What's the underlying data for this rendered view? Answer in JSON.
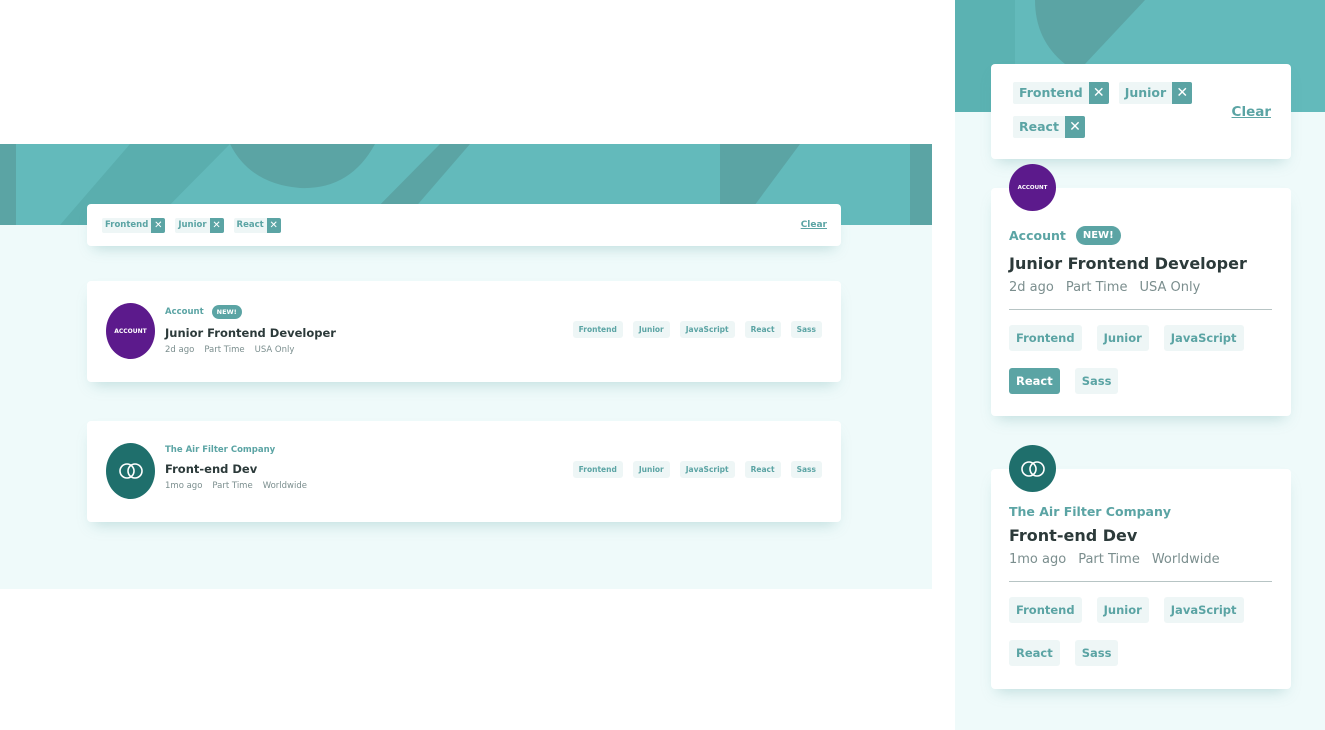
{
  "colors": {
    "primary": "#5ba4a4",
    "background": "#effafa",
    "filter_tablet": "#eef6f6",
    "dark_text": "#2c3a3a",
    "gray_text": "#7b8e8e",
    "logo_account": "#5c1a8c",
    "logo_air": "#1f6f6c"
  },
  "filters": {
    "chips": [
      {
        "label": "Frontend",
        "icon": "close-icon"
      },
      {
        "label": "Junior",
        "icon": "close-icon"
      },
      {
        "label": "React",
        "icon": "close-icon"
      }
    ],
    "remove_glyph": "✕",
    "clear_label": "Clear"
  },
  "jobs": [
    {
      "logo_text": "ACCOUNT",
      "logo_icon": "account-logo-icon",
      "company": "Account",
      "badge": "NEW!",
      "position": "Junior Frontend Developer",
      "posted": "2d ago",
      "contract": "Part Time",
      "location": "USA Only",
      "tags": [
        "Frontend",
        "Junior",
        "JavaScript",
        "React",
        "Sass"
      ],
      "active_tag_mobile": "React"
    },
    {
      "logo_text": "",
      "logo_icon": "rings-logo-icon",
      "company": "The Air Filter Company",
      "badge": "",
      "position": "Front-end Dev",
      "posted": "1mo ago",
      "contract": "Part Time",
      "location": "Worldwide",
      "tags": [
        "Frontend",
        "Junior",
        "JavaScript",
        "React",
        "Sass"
      ],
      "active_tag_mobile": ""
    }
  ]
}
